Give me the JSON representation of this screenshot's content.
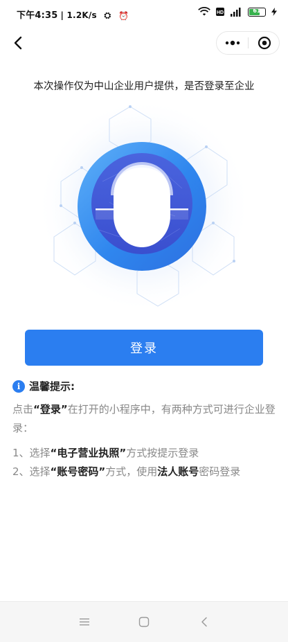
{
  "status_bar": {
    "time": "下午4:35",
    "net_speed": "| 1.2K/s",
    "battery_level": "61"
  },
  "navbar": {
    "back_icon": "chevron-left-icon",
    "more_icon": "more-dots-icon",
    "close_icon": "target-close-icon"
  },
  "main": {
    "notice": "本次操作仅为中山企业用户提供，是否登录至企业",
    "hero_icon": "face-recognition-icon",
    "login_button": "登录"
  },
  "tips": {
    "title": "温馨提示:",
    "intro_prefix": "点击",
    "intro_bold": "“登录”",
    "intro_suffix": "在打开的小程序中，有两种方式可进行企业登录：",
    "step1_prefix": "1、选择",
    "step1_bold": "“电子营业执照”",
    "step1_suffix": "方式按提示登录",
    "step2_prefix": "2、选择",
    "step2_bold": "“账号密码”",
    "step2_middle": "方式，使用",
    "step2_bold2": "法人账号",
    "step2_suffix": "密码登录"
  },
  "colors": {
    "accent": "#2b7ef0",
    "ring_outer": "#3a8ff2",
    "ring_inner": "#3f58d8"
  },
  "system_nav": {
    "menu_icon": "menu-icon",
    "home_icon": "home-icon",
    "back_icon": "back-icon"
  }
}
